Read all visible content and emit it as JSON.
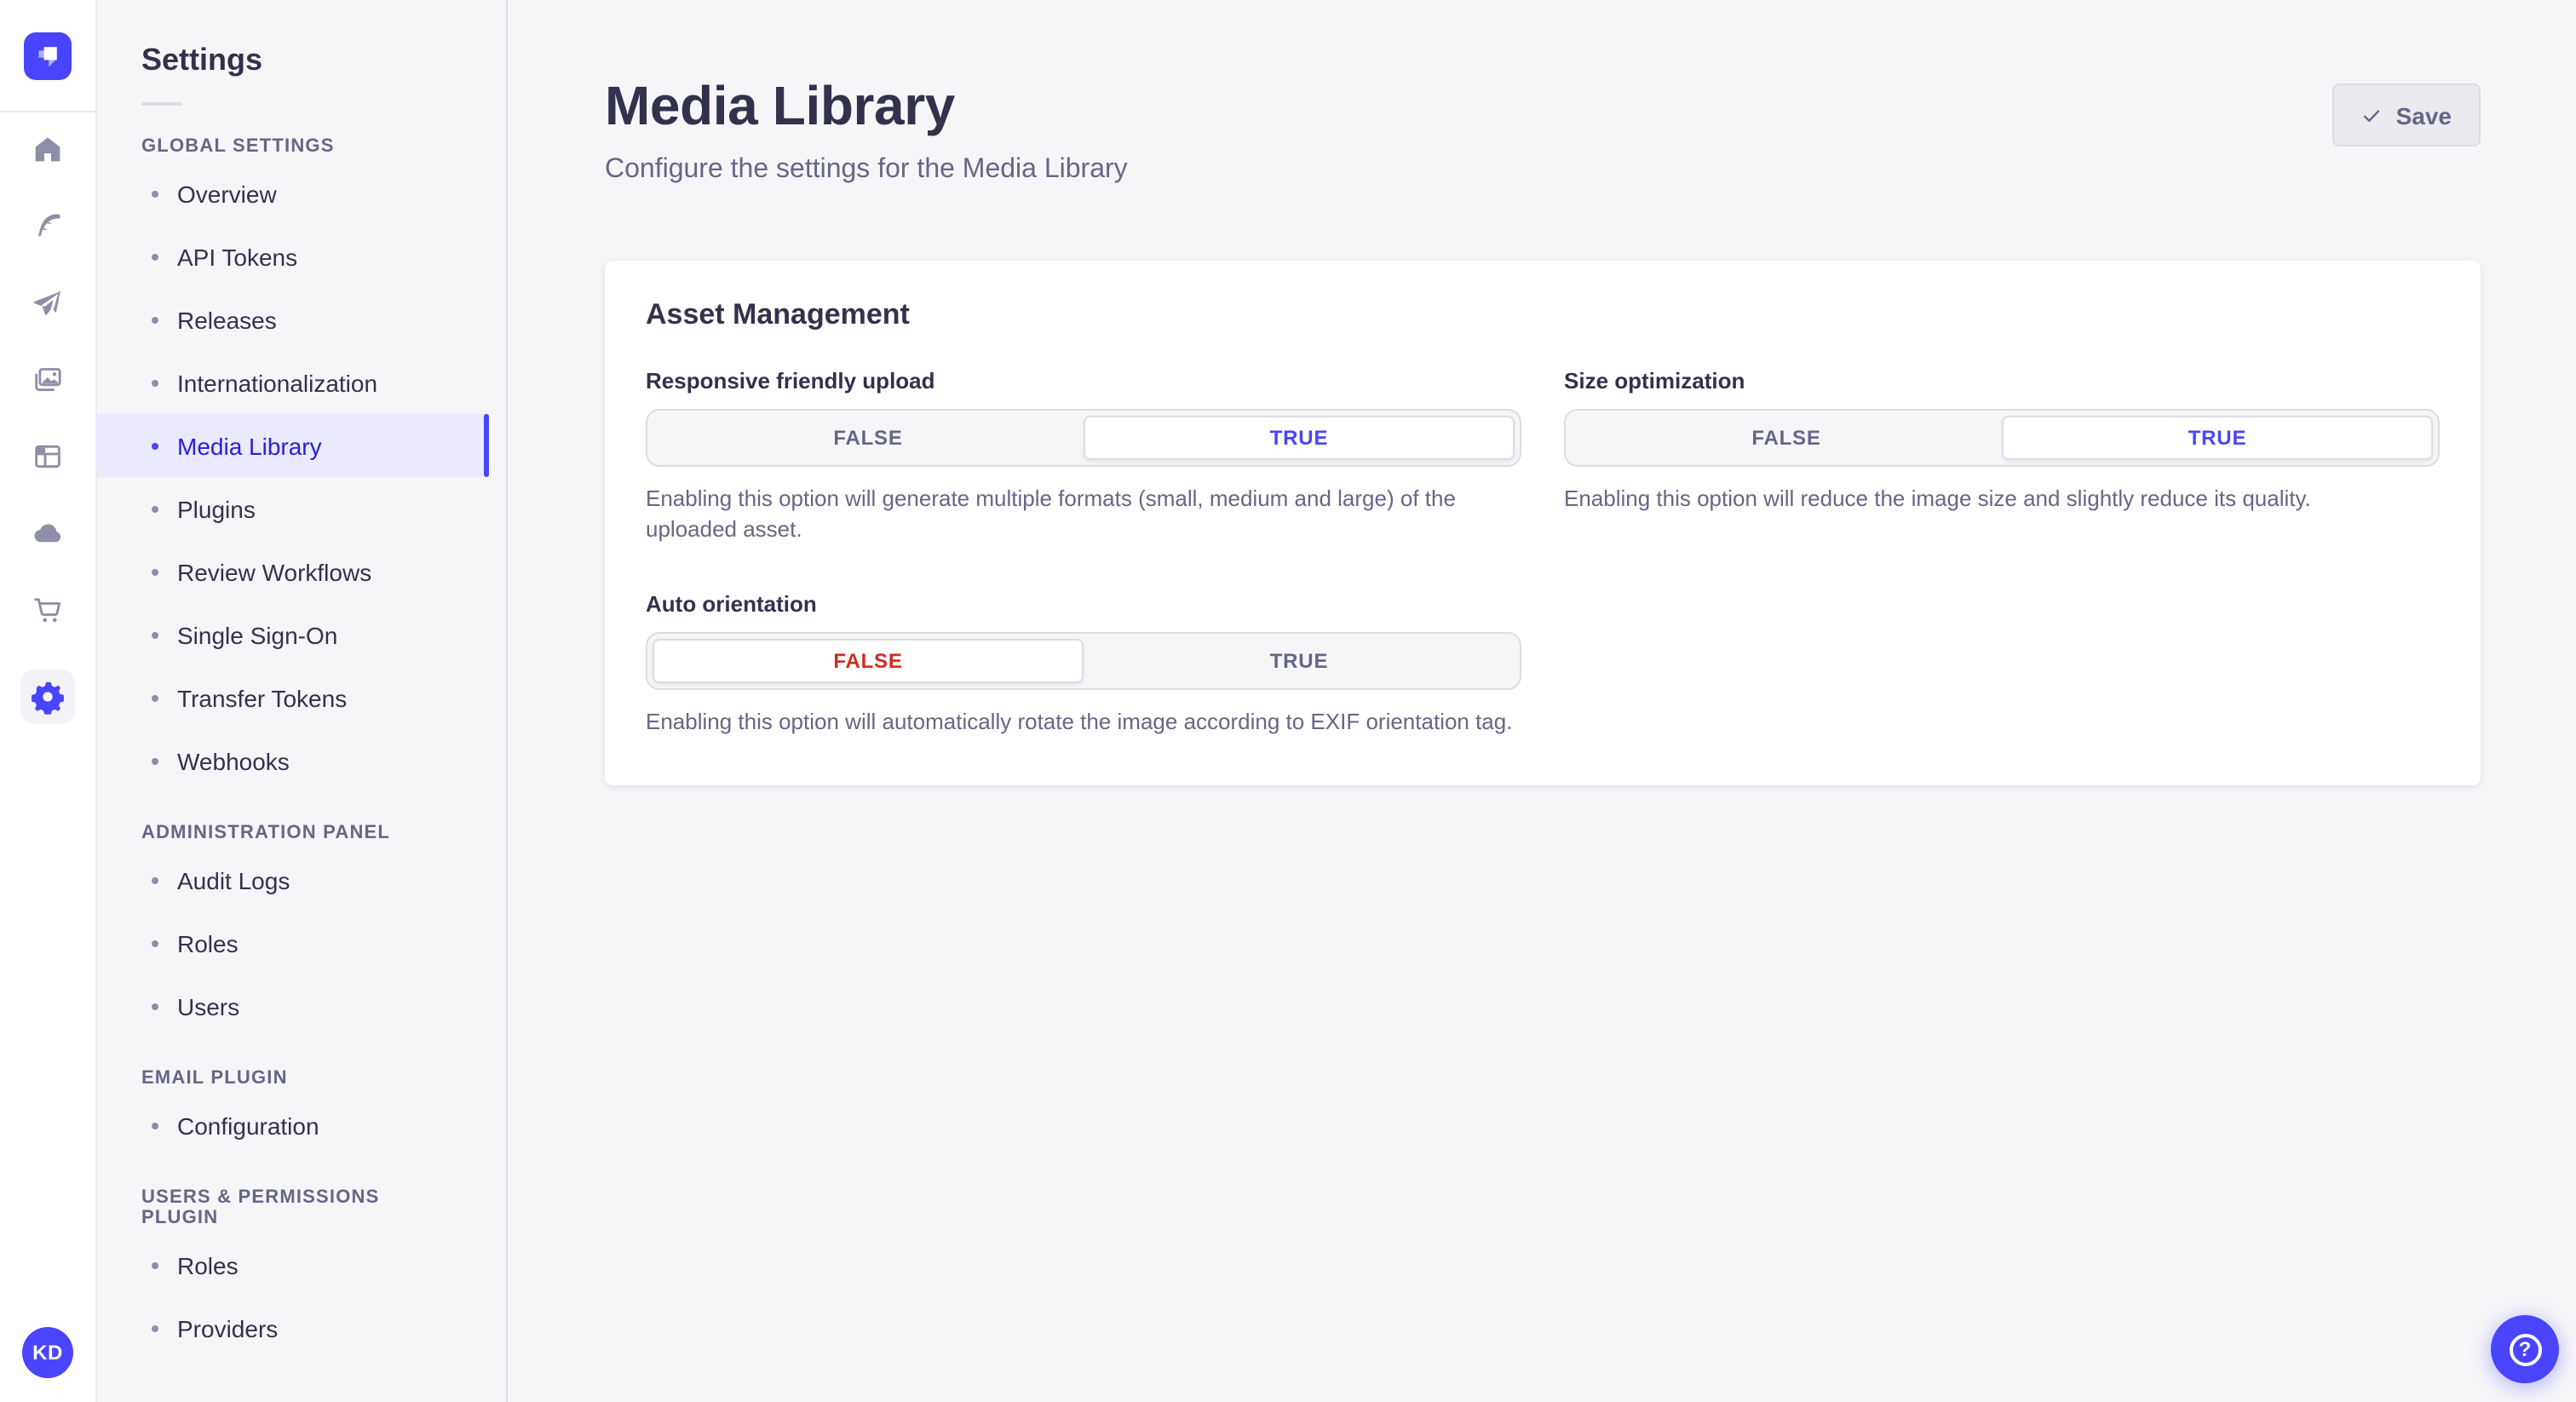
{
  "colors": {
    "primary": "#4945ff",
    "primary_text_active": "#271fe0",
    "primary_bg_active": "#eae9fe",
    "danger": "#d02b20",
    "heading_text": "#32324d",
    "secondary_text": "#666687",
    "border": "#dcdce4",
    "app_background": "#f6f6f9",
    "surface": "#ffffff"
  },
  "rail": {
    "logo_name": "strapi-logo",
    "icons": [
      {
        "name": "home-icon"
      },
      {
        "name": "feather-icon"
      },
      {
        "name": "paper-plane-icon"
      },
      {
        "name": "media-library-icon"
      },
      {
        "name": "layout-icon"
      },
      {
        "name": "cloud-icon"
      },
      {
        "name": "cart-icon"
      },
      {
        "name": "settings-gear-icon",
        "active": true
      }
    ],
    "avatar_initials": "KD"
  },
  "sidebar": {
    "title": "Settings",
    "sections": [
      {
        "label": "GLOBAL SETTINGS",
        "items": [
          {
            "label": "Overview"
          },
          {
            "label": "API Tokens"
          },
          {
            "label": "Releases"
          },
          {
            "label": "Internationalization"
          },
          {
            "label": "Media Library",
            "active": true
          },
          {
            "label": "Plugins"
          },
          {
            "label": "Review Workflows"
          },
          {
            "label": "Single Sign-On"
          },
          {
            "label": "Transfer Tokens"
          },
          {
            "label": "Webhooks"
          }
        ]
      },
      {
        "label": "ADMINISTRATION PANEL",
        "items": [
          {
            "label": "Audit Logs"
          },
          {
            "label": "Roles"
          },
          {
            "label": "Users"
          }
        ]
      },
      {
        "label": "EMAIL PLUGIN",
        "items": [
          {
            "label": "Configuration"
          }
        ]
      },
      {
        "label": "USERS & PERMISSIONS PLUGIN",
        "items": [
          {
            "label": "Roles"
          },
          {
            "label": "Providers"
          }
        ]
      }
    ]
  },
  "header": {
    "title": "Media Library",
    "subtitle": "Configure the settings for the Media Library",
    "save_label": "Save"
  },
  "card": {
    "title": "Asset Management",
    "fields": [
      {
        "label": "Responsive friendly upload",
        "options": [
          "FALSE",
          "TRUE"
        ],
        "selected": "TRUE",
        "description": "Enabling this option will generate multiple formats (small, medium and large) of the uploaded asset."
      },
      {
        "label": "Size optimization",
        "options": [
          "FALSE",
          "TRUE"
        ],
        "selected": "TRUE",
        "description": "Enabling this option will reduce the image size and slightly reduce its quality."
      },
      {
        "label": "Auto orientation",
        "options": [
          "FALSE",
          "TRUE"
        ],
        "selected": "FALSE",
        "description": "Enabling this option will automatically rotate the image according to EXIF orientation tag."
      }
    ]
  },
  "help": {
    "label": "?"
  }
}
